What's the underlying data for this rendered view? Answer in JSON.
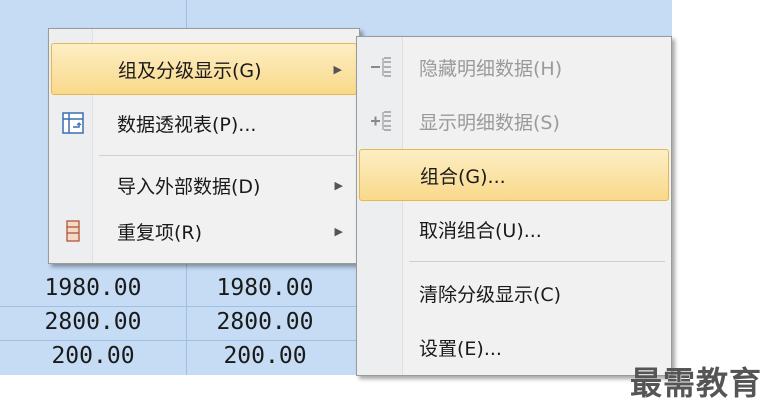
{
  "colors": {
    "selection": "#c5dcf4",
    "menu_bg": "#f1f1f1",
    "highlight": "#f9d98a",
    "disabled_text": "#9a9a9a"
  },
  "sheet": {
    "rows": [
      [
        "1980.00",
        "1980.00"
      ],
      [
        "2800.00",
        "2800.00"
      ],
      [
        "200.00",
        "200.00"
      ]
    ]
  },
  "menu": {
    "items": [
      {
        "label": "组及分级显示(G)",
        "icon": "",
        "has_submenu": true
      },
      {
        "label": "数据透视表(P)...",
        "icon": "pivot-table-icon",
        "has_submenu": false
      },
      {
        "label": "导入外部数据(D)",
        "icon": "",
        "has_submenu": true
      },
      {
        "label": "重复项(R)",
        "icon": "duplicates-icon",
        "has_submenu": true
      }
    ]
  },
  "submenu": {
    "items": [
      {
        "label": "隐藏明细数据(H)",
        "icon": "hide-detail-icon",
        "disabled": true
      },
      {
        "label": "显示明细数据(S)",
        "icon": "show-detail-icon",
        "disabled": true
      },
      {
        "label": "组合(G)...",
        "icon": "",
        "disabled": false
      },
      {
        "label": "取消组合(U)...",
        "icon": "",
        "disabled": false
      },
      {
        "label": "清除分级显示(C)",
        "icon": "",
        "disabled": false
      },
      {
        "label": "设置(E)...",
        "icon": "",
        "disabled": false
      }
    ]
  },
  "watermark": "最需教育"
}
